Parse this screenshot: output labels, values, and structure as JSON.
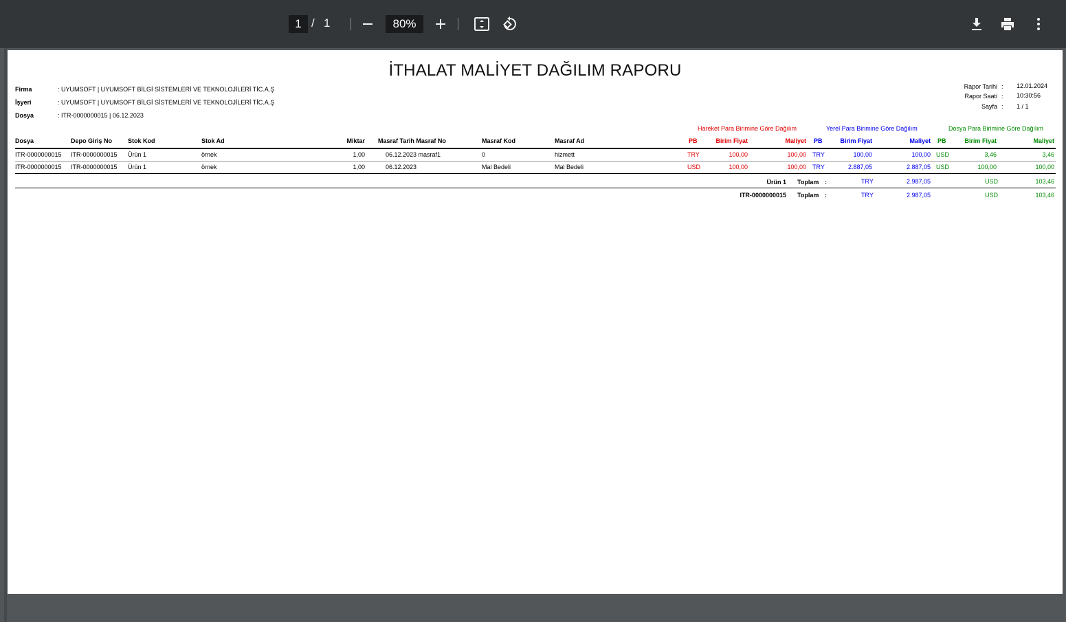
{
  "toolbar": {
    "current_page": "1",
    "separator": "/",
    "total_pages": "1",
    "zoom": "80%",
    "icons": [
      "minus-icon",
      "plus-icon",
      "fit-page-icon",
      "rotate-icon",
      "download-icon",
      "print-icon",
      "more-vert-icon"
    ]
  },
  "report": {
    "title": "İTHALAT MALİYET DAĞILIM RAPORU",
    "info": {
      "firma_label": "Firma",
      "firma_value": ": UYUMSOFT | UYUMSOFT BİLGİ SİSTEMLERİ VE TEKNOLOJİLERİ TİC.A.Ş",
      "isyeri_label": "İşyeri",
      "isyeri_value": ": UYUMSOFT | UYUMSOFT BİLGİ SİSTEMLERİ VE TEKNOLOJİLERİ TİC.A.Ş",
      "dosya_label": "Dosya",
      "dosya_value": ": ITR-0000000015 | 06.12.2023"
    },
    "meta": {
      "rapor_tarihi_label": "Rapor Tarihi",
      "rapor_tarihi": "12.01.2024",
      "rapor_saati_label": "Rapor Saati",
      "rapor_saati": "10:30:56",
      "sayfa_label": "Sayfa",
      "sayfa": "1 / 1",
      "colon": ":"
    },
    "groups": {
      "hareket": "Hareket Para Birimine Göre Dağılım",
      "yerel": "Yerel Para Birimine Göre Dağılım",
      "dosya": "Dosya Para Birimine Göre Dağılım"
    },
    "headers": {
      "dosya": "Dosya",
      "depo_giris_no": "Depo Giriş No",
      "stok_kod": "Stok Kod",
      "stok_ad": "Stok Ad",
      "miktar": "Miktar",
      "masraf_tarih_no": "Masraf Tarih Masraf No",
      "masraf_kod": "Masraf Kod",
      "masraf_ad": "Masraf Ad",
      "pb": "PB",
      "birim_fiyat": "Birim Fiyat",
      "maliyet": "Maliyet"
    },
    "rows": [
      {
        "dosya": "ITR-0000000015",
        "depo": "ITR-0000000015",
        "stok_kod": "Ürün 1",
        "stok_ad": "örnek",
        "miktar": "1,00",
        "masraf": "06.12.2023 masraf1",
        "masraf_kod": "0",
        "masraf_ad": "hizmett",
        "h_pb": "TRY",
        "h_birim": "100,00",
        "h_maliyet": "100,00",
        "y_pb": "TRY",
        "y_birim": "100,00",
        "y_maliyet": "100,00",
        "d_pb": "USD",
        "d_birim": "3,46",
        "d_maliyet": "3,46"
      },
      {
        "dosya": "ITR-0000000015",
        "depo": "ITR-0000000015",
        "stok_kod": "Ürün 1",
        "stok_ad": "örnek",
        "miktar": "1,00",
        "masraf": "06.12.2023",
        "masraf_kod": "Mal Bedeli",
        "masraf_ad": "Mal Bedeli",
        "h_pb": "USD",
        "h_birim": "100,00",
        "h_maliyet": "100,00",
        "y_pb": "TRY",
        "y_birim": "2.887,05",
        "y_maliyet": "2.887,05",
        "d_pb": "USD",
        "d_birim": "100,00",
        "d_maliyet": "100,00"
      }
    ],
    "totals": [
      {
        "label": "Ürün 1",
        "toplam": "Toplam",
        "colon": ":",
        "y_pb": "TRY",
        "y_maliyet": "2.987,05",
        "d_pb": "USD",
        "d_maliyet": "103,46"
      },
      {
        "label": "ITR-0000000015",
        "toplam": "Toplam",
        "colon": ":",
        "y_pb": "TRY",
        "y_maliyet": "2.987,05",
        "d_pb": "USD",
        "d_maliyet": "103,46"
      }
    ]
  },
  "colors": {
    "toolbar_bg": "#323639",
    "viewer_bg": "#525659",
    "hareket": "#e00000",
    "yerel": "#0000ee",
    "dosya": "#008a00"
  }
}
